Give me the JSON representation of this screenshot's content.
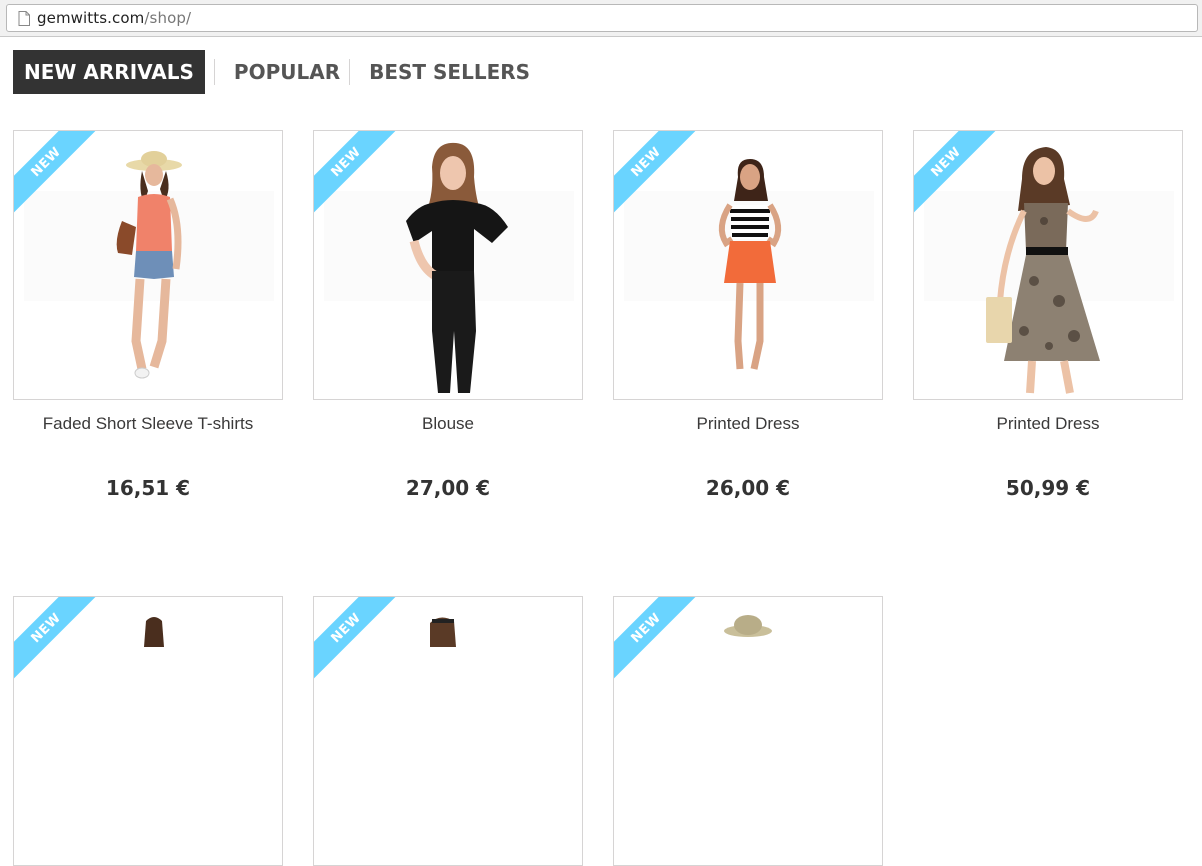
{
  "browser": {
    "url_domain": "gemwitts.com",
    "url_path": "/shop/"
  },
  "tabs": [
    {
      "label": "NEW ARRIVALS",
      "active": true
    },
    {
      "label": "POPULAR",
      "active": false
    },
    {
      "label": "BEST SELLERS",
      "active": false
    }
  ],
  "badge_label": "NEW",
  "colors": {
    "ribbon": "#6ad4ff",
    "active_tab_bg": "#333333"
  },
  "products": [
    {
      "name": "Faded Short Sleeve T-shirts",
      "price": "16,51 €"
    },
    {
      "name": "Blouse",
      "price": "27,00 €"
    },
    {
      "name": "Printed Dress",
      "price": "26,00 €"
    },
    {
      "name": "Printed Dress",
      "price": "50,99 €"
    },
    {
      "name": "",
      "price": ""
    },
    {
      "name": "",
      "price": ""
    },
    {
      "name": "",
      "price": ""
    }
  ]
}
